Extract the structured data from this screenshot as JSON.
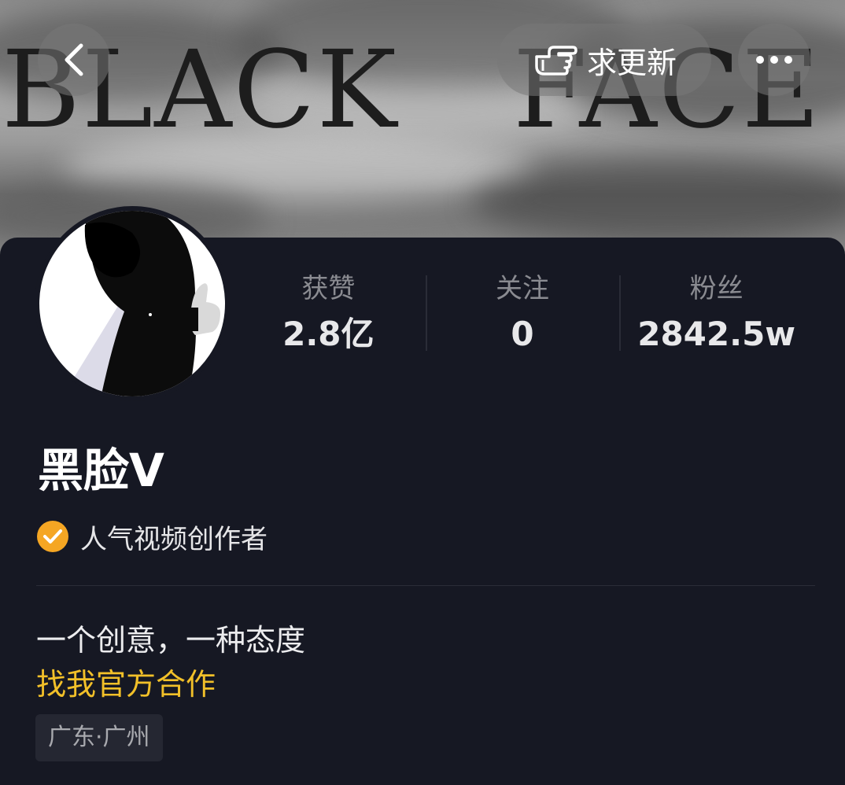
{
  "banner": {
    "word_left": "BLACK",
    "word_right": "FACE"
  },
  "topbar": {
    "back_icon": "chevron-left-icon",
    "update_button_icon": "pointing-hand-icon",
    "update_button_label": "求更新",
    "more_icon": "more-dots-icon"
  },
  "profile": {
    "stats": [
      {
        "label": "获赞",
        "value": "2.8亿"
      },
      {
        "label": "关注",
        "value": "0"
      },
      {
        "label": "粉丝",
        "value": "2842.5w"
      }
    ],
    "nickname": "黑脸V",
    "verified_label": "人气视频创作者",
    "verified_icon": "check-badge-icon",
    "bio": "一个创意，一种态度",
    "bio_link": "找我官方合作",
    "location": "广东·广州"
  },
  "colors": {
    "background": "#161823",
    "accent_yellow": "#f2c029",
    "badge_orange": "#f5a623"
  }
}
